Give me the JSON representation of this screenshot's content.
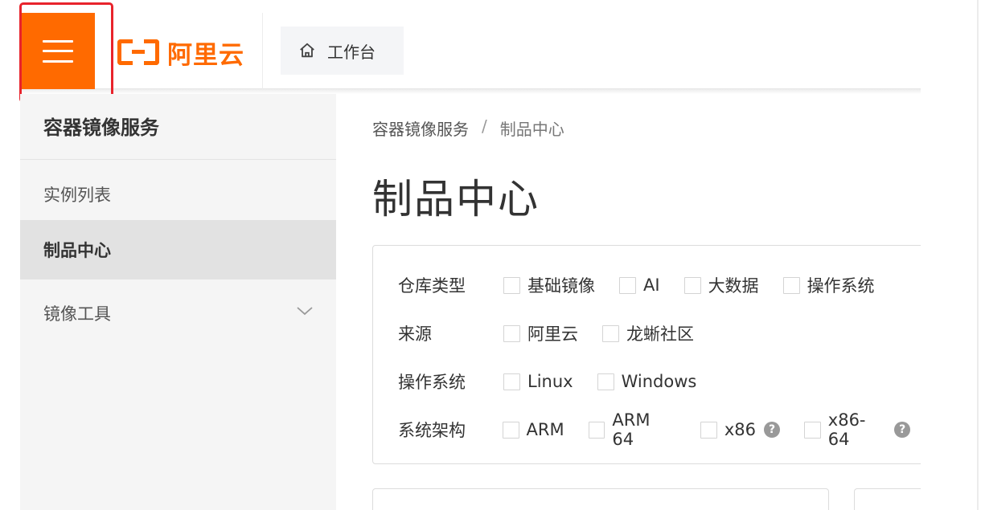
{
  "header": {
    "logo_text": "阿里云",
    "workbench_label": "工作台"
  },
  "sidebar": {
    "title": "容器镜像服务",
    "items": [
      {
        "label": "实例列表"
      },
      {
        "label": "制品中心"
      },
      {
        "label": "镜像工具"
      }
    ]
  },
  "breadcrumb": {
    "parent": "容器镜像服务",
    "separator": "/",
    "current": "制品中心"
  },
  "page": {
    "title": "制品中心"
  },
  "filters": {
    "repo_type": {
      "label": "仓库类型",
      "options": [
        "基础镜像",
        "AI",
        "大数据",
        "操作系统"
      ]
    },
    "source": {
      "label": "来源",
      "options": [
        "阿里云",
        "龙蜥社区"
      ]
    },
    "os": {
      "label": "操作系统",
      "options": [
        "Linux",
        "Windows"
      ]
    },
    "arch": {
      "label": "系统架构",
      "options": [
        "ARM",
        "ARM 64",
        "x86",
        "x86-64"
      ],
      "help_mark": "?"
    }
  },
  "colors": {
    "brand": "#ff6a00",
    "highlight": "#e8232c"
  }
}
